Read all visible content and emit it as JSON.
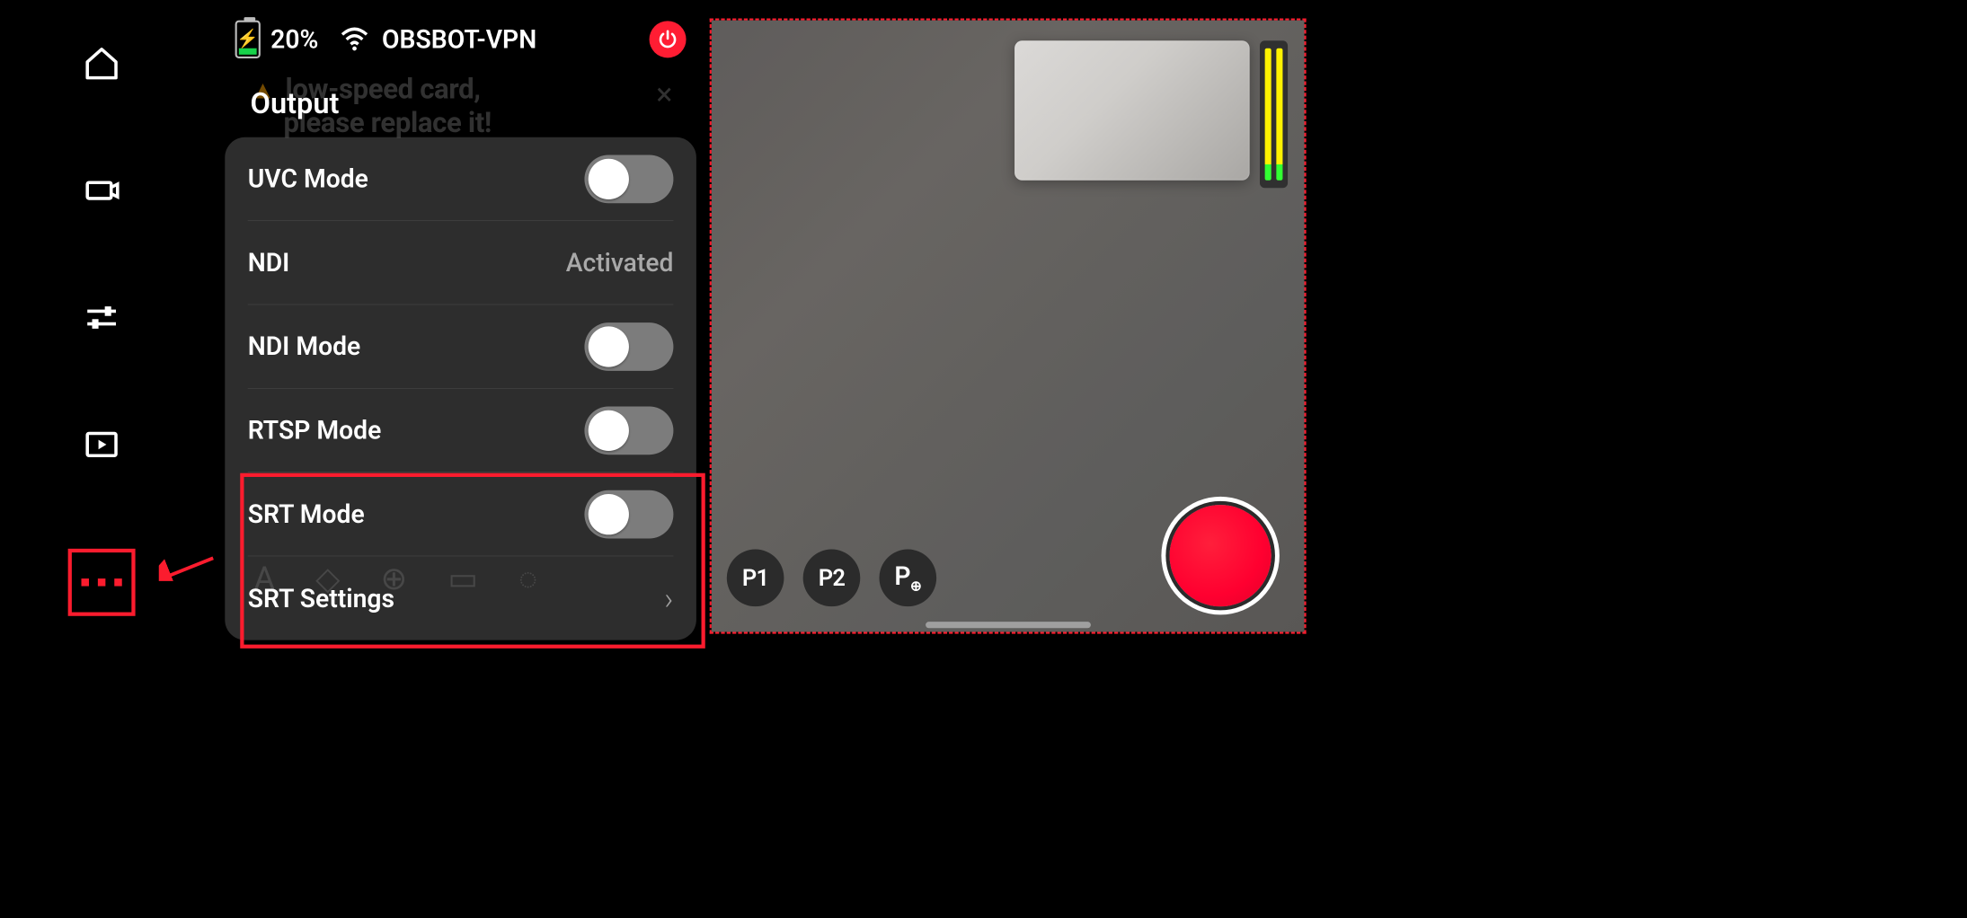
{
  "status_bar": {
    "battery_pct": "20%",
    "wifi_name": "OBSBOT-VPN"
  },
  "ghost_warning": {
    "line1": "low-speed card,",
    "line2": "please replace it!"
  },
  "drawer": {
    "section_title": "Output",
    "rows": {
      "uvc": {
        "label": "UVC Mode"
      },
      "ndi": {
        "label": "NDI",
        "value": "Activated"
      },
      "ndim": {
        "label": "NDI Mode"
      },
      "rtsp": {
        "label": "RTSP Mode"
      },
      "srt": {
        "label": "SRT Mode"
      },
      "srtcfg": {
        "label": "SRT Settings"
      }
    }
  },
  "presets": {
    "p1": "P1",
    "p2": "P2",
    "padd": "P₊"
  }
}
